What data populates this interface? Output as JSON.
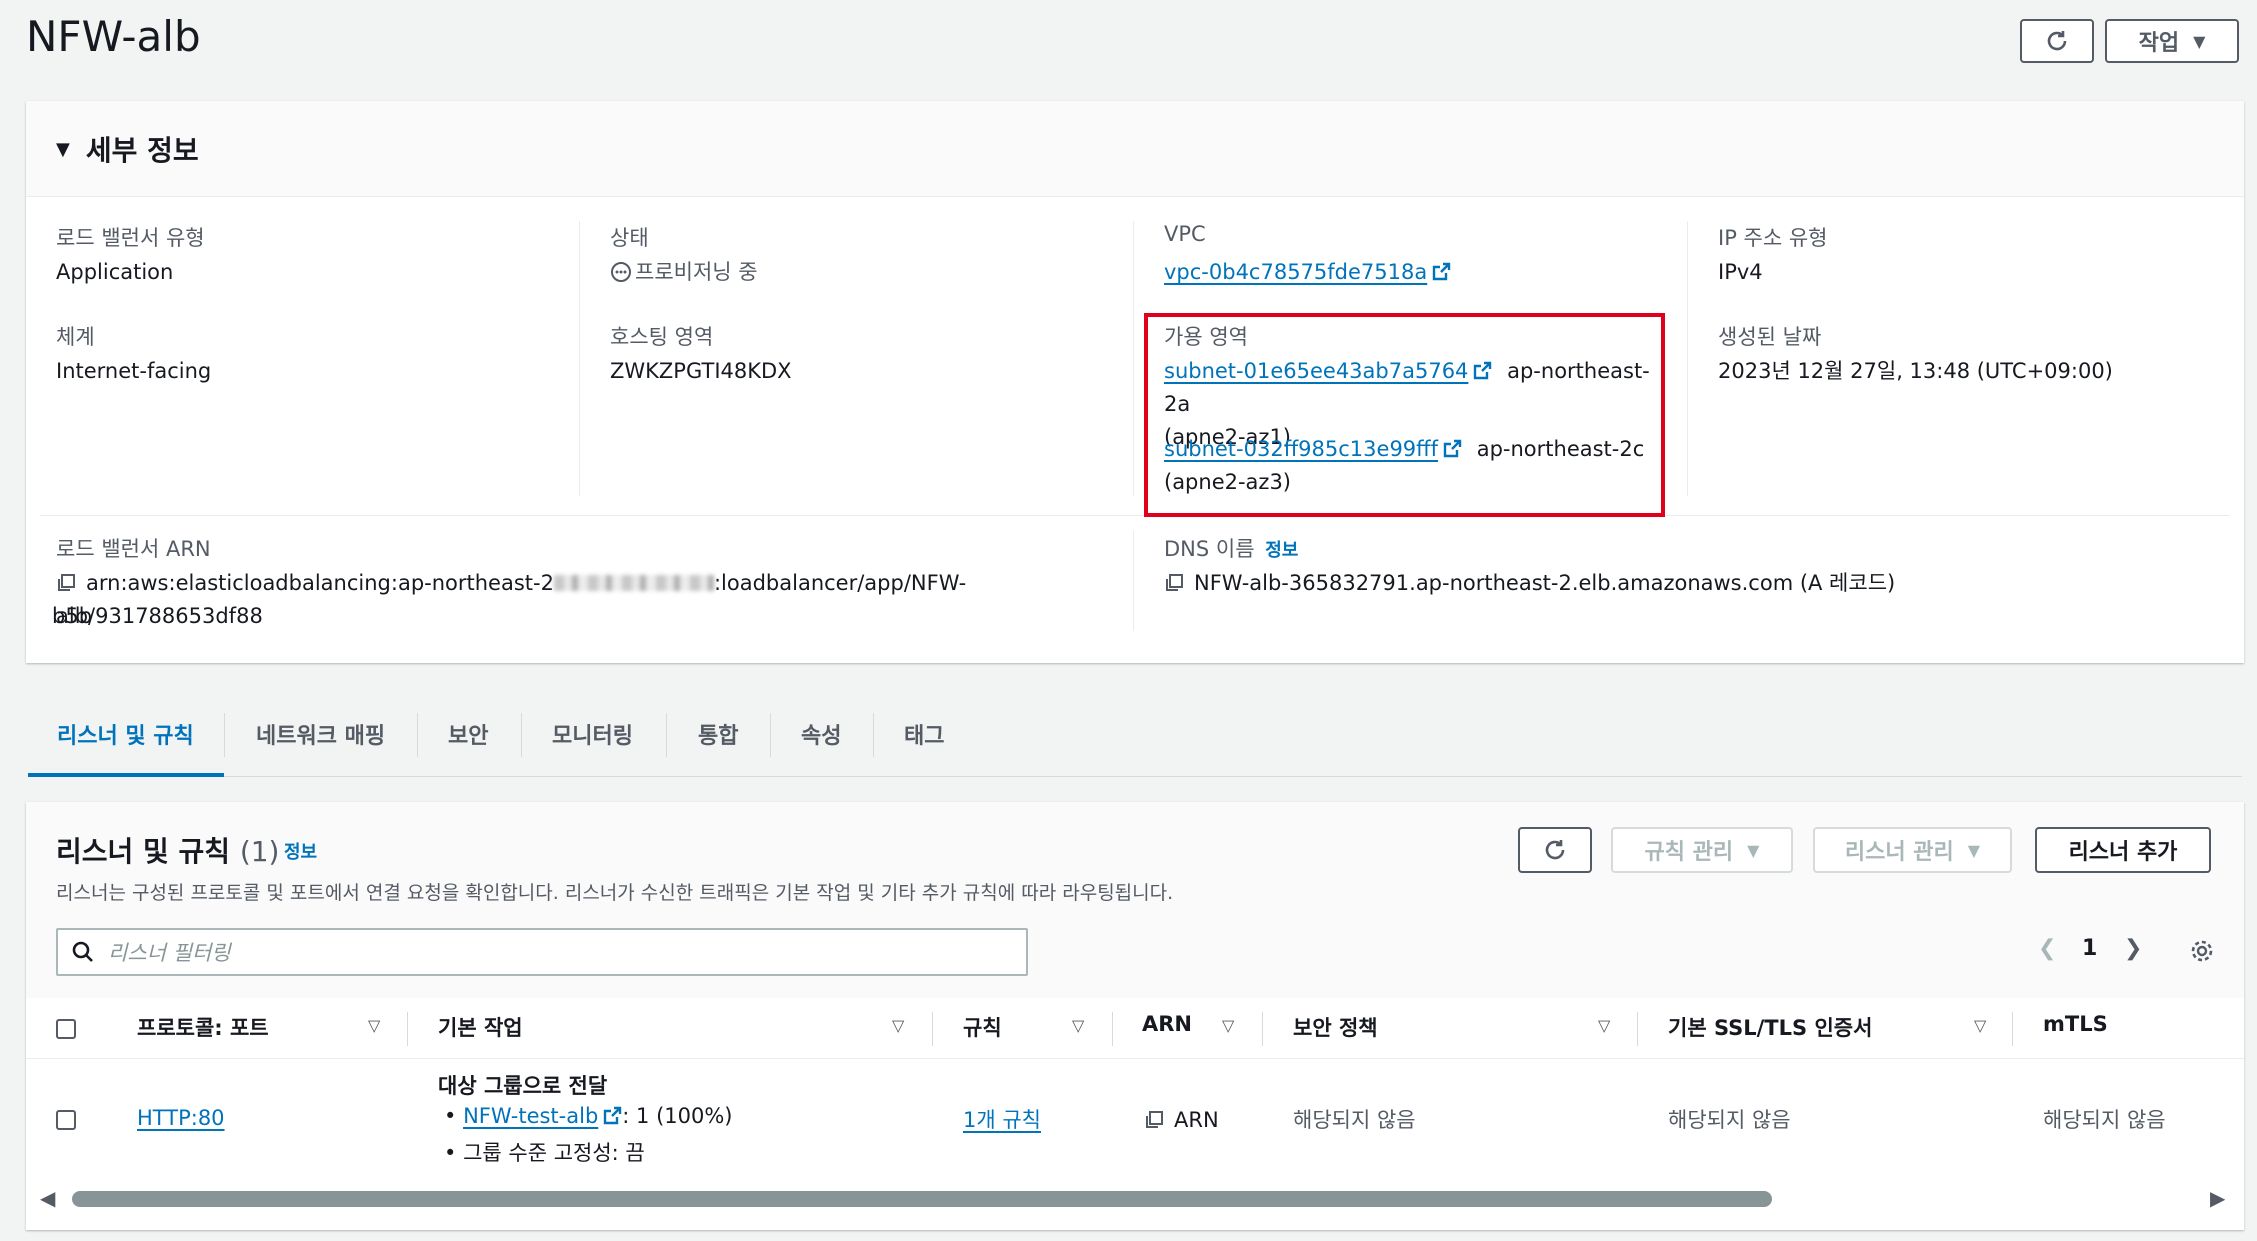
{
  "header": {
    "title": "NFW-alb",
    "actions_label": "작업"
  },
  "details": {
    "title": "세부 정보",
    "lb_type_label": "로드 밸런서 유형",
    "lb_type_value": "Application",
    "scheme_label": "체계",
    "scheme_value": "Internet-facing",
    "state_label": "상태",
    "state_value": "프로비저닝 중",
    "hosted_zone_label": "호스팅 영역",
    "hosted_zone_value": "ZWKZPGTI48KDX",
    "vpc_label": "VPC",
    "vpc_value": "vpc-0b4c78575fde7518a",
    "az_label": "가용 영역",
    "az_items": [
      {
        "subnet": "subnet-01e65ee43ab7a5764",
        "zone": "ap-northeast-2a",
        "az_id": "(apne2-az1)"
      },
      {
        "subnet": "subnet-032ff985c13e99fff",
        "zone": "ap-northeast-2c",
        "az_id": "(apne2-az3)"
      }
    ],
    "ip_type_label": "IP 주소 유형",
    "ip_type_value": "IPv4",
    "created_label": "생성된 날짜",
    "created_value": "2023년 12월 27일, 13:48 (UTC+09:00)",
    "arn_label": "로드 밸런서 ARN",
    "arn_prefix": "arn:aws:elasticloadbalancing:ap-northeast-2",
    "arn_suffix": ":loadbalancer/app/NFW-alb/931788653df88",
    "arn_wrap": "b5b",
    "dns_label": "DNS 이름",
    "dns_info": "정보",
    "dns_value": "NFW-alb-365832791.ap-northeast-2.elb.amazonaws.com (A 레코드)"
  },
  "tabs": [
    {
      "label": "리스너 및 규칙"
    },
    {
      "label": "네트워크 매핑"
    },
    {
      "label": "보안"
    },
    {
      "label": "모니터링"
    },
    {
      "label": "통합"
    },
    {
      "label": "속성"
    },
    {
      "label": "태그"
    }
  ],
  "listeners": {
    "title": "리스너 및 규칙",
    "count": "(1)",
    "info": "정보",
    "description": "리스너는 구성된 프로토콜 및 포트에서 연결 요청을 확인합니다. 리스너가 수신한 트래픽은 기본 작업 및 기타 추가 규칙에 따라 라우팅됩니다.",
    "manage_rules": "규칙 관리",
    "manage_listener": "리스너 관리",
    "add_listener": "리스너 추가",
    "filter_placeholder": "리스너 필터링",
    "page": "1",
    "columns": [
      "프로토콜: 포트",
      "기본 작업",
      "규칙",
      "ARN",
      "보안 정책",
      "기본 SSL/TLS 인증서",
      "mTLS"
    ],
    "row": {
      "protocol_port": "HTTP:80",
      "action_title": "대상 그룹으로 전달",
      "target_group": "NFW-test-alb",
      "target_weight": ": 1 (100%)",
      "stickiness": "그룹 수준 고정성: 끔",
      "rules": "1개 규칙",
      "arn": "ARN",
      "security_policy": "해당되지 않음",
      "ssl_cert": "해당되지 않음",
      "mtls": "해당되지 않음"
    }
  }
}
